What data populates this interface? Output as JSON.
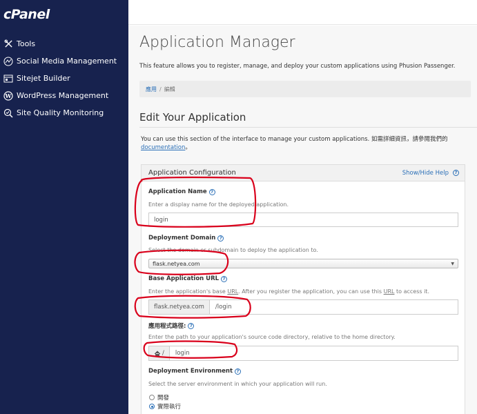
{
  "brand": {
    "logo_text": "cPanel"
  },
  "sidebar": {
    "items": [
      {
        "label": "Tools",
        "icon": "tools-icon"
      },
      {
        "label": "Social Media Management",
        "icon": "social-media-icon"
      },
      {
        "label": "Sitejet Builder",
        "icon": "sitejet-icon"
      },
      {
        "label": "WordPress Management",
        "icon": "wordpress-icon"
      },
      {
        "label": "Site Quality Monitoring",
        "icon": "site-quality-icon"
      }
    ]
  },
  "page": {
    "title": "Application Manager",
    "description": "This feature allows you to register, manage, and deploy your custom applications using Phusion Passenger.",
    "breadcrumb": {
      "root": "應用",
      "separator": "/",
      "current": "編輯"
    },
    "section_title": "Edit Your Application",
    "section_desc_prefix": "You can use this section of the interface to manage your custom applications. 如需詳細資訊，請參閱我們的",
    "section_desc_link": "documentation",
    "section_desc_suffix": "。"
  },
  "panel": {
    "title": "Application Configuration",
    "toggle_help": "Show/Hide Help"
  },
  "fields": {
    "app_name": {
      "label": "Application Name",
      "help": "Enter a display name for the deployed application.",
      "value": "login"
    },
    "domain": {
      "label": "Deployment Domain",
      "help": "Select the domain or subdomain to deploy the application to.",
      "value": "flask.netyea.com"
    },
    "base_url": {
      "label": "Base Application URL",
      "help_a": "Enter the application's base ",
      "help_url": "URL",
      "help_b": ". After you register the application, you can use this ",
      "help_c": " to access it.",
      "prefix": "flask.netyea.com",
      "value": "/login"
    },
    "app_path": {
      "label": "應用程式路徑:",
      "help": "Enter the path to your application's source code directory, relative to the home directory.",
      "prefix": "/",
      "value": "login"
    },
    "environment": {
      "label": "Deployment Environment",
      "help": "Select the server environment in which your application will run.",
      "options": [
        "開發",
        "實際執行"
      ],
      "selected": "實際執行"
    }
  },
  "colors": {
    "sidebar_bg": "#17224e",
    "link": "#2a6fb7",
    "annotation": "#d9001b"
  }
}
